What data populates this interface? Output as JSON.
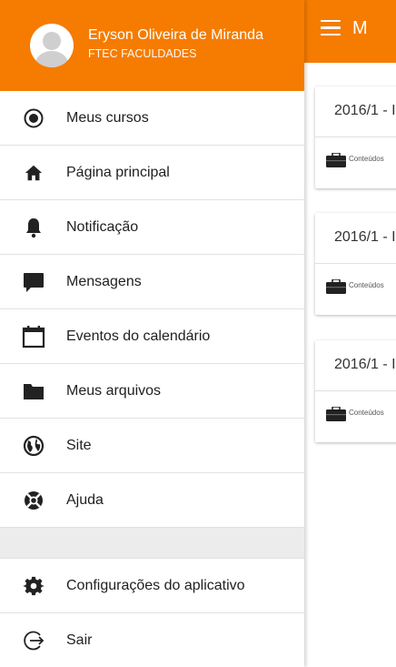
{
  "app": {
    "title_visible": "M",
    "brand_color": "#f57c00",
    "courses": [
      {
        "title": "2016/1 - I",
        "label": "Conteúdos"
      },
      {
        "title": "2016/1 - I",
        "label": "Conteúdos"
      },
      {
        "title": "2016/1 - I",
        "label": "Conteúdos"
      }
    ]
  },
  "drawer": {
    "user": {
      "name": "Eryson Oliveira de Miranda",
      "organization": "FTEC FACULDADES"
    },
    "items": [
      {
        "label": "Meus cursos",
        "icon": "radio-target-icon"
      },
      {
        "label": "Página principal",
        "icon": "home-icon"
      },
      {
        "label": "Notificação",
        "icon": "bell-icon"
      },
      {
        "label": "Mensagens",
        "icon": "message-bubble-icon"
      },
      {
        "label": "Eventos do calendário",
        "icon": "calendar-icon"
      },
      {
        "label": "Meus arquivos",
        "icon": "folder-icon"
      },
      {
        "label": "Site",
        "icon": "globe-icon"
      },
      {
        "label": "Ajuda",
        "icon": "lifebuoy-icon"
      }
    ],
    "bottom_items": [
      {
        "label": "Configurações do aplicativo",
        "icon": "gear-icon"
      },
      {
        "label": "Sair",
        "icon": "logout-icon"
      }
    ]
  }
}
